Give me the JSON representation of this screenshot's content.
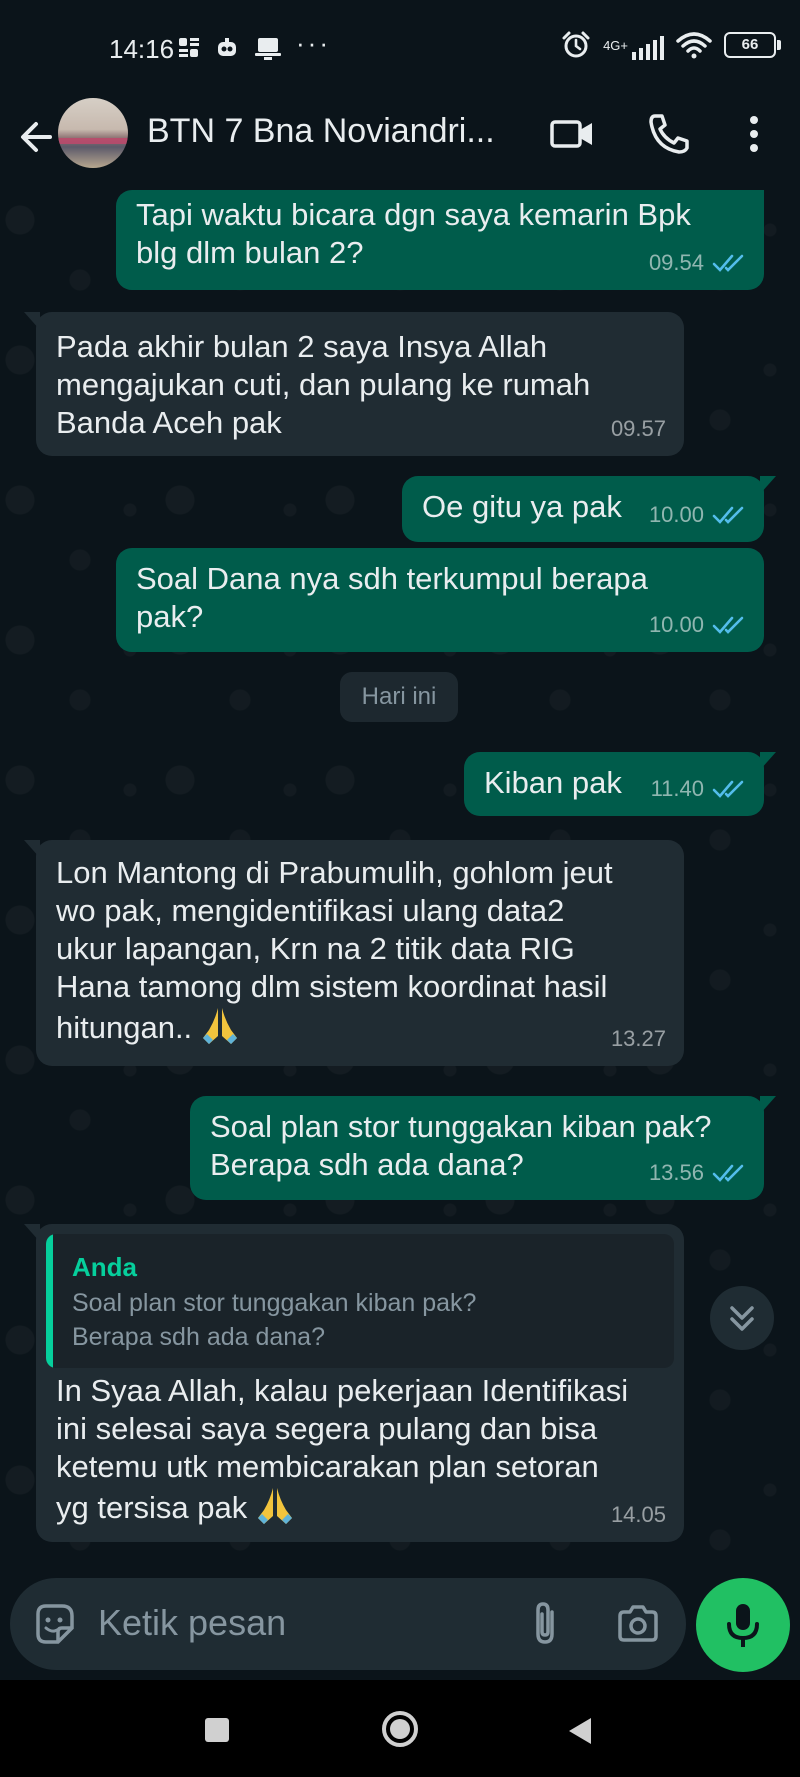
{
  "status_bar": {
    "time": "14:16",
    "overflow": "···",
    "network": "4G+",
    "battery": "66",
    "icons": [
      "grid-icon",
      "robot-icon",
      "laptop-icon",
      "alarm-icon",
      "signal-icon",
      "wifi-icon",
      "battery-icon"
    ]
  },
  "header": {
    "contact_name": "BTN 7 Bna Noviandri...",
    "icons": [
      "back-arrow-icon",
      "video-call-icon",
      "phone-icon",
      "more-vertical-icon"
    ]
  },
  "date_separator": "Hari ini",
  "messages": [
    {
      "dir": "out",
      "text": "Tapi waktu bicara dgn saya kemarin Bpk\nblg dlm bulan 2?",
      "time": "09.54"
    },
    {
      "dir": "in",
      "text": "Pada akhir bulan 2 saya Insya Allah\nmengajukan cuti, dan pulang ke rumah\nBanda Aceh pak",
      "time": "09.57"
    },
    {
      "dir": "out",
      "text": "Oe gitu ya pak",
      "time": "10.00"
    },
    {
      "dir": "out",
      "text": "Soal Dana nya sdh terkumpul berapa\npak?",
      "time": "10.00"
    },
    {
      "dir": "out",
      "text": "Kiban pak",
      "time": "11.40"
    },
    {
      "dir": "in",
      "text": "Lon Mantong di Prabumulih, gohlom jeut\nwo pak, mengidentifikasi ulang data2\nukur lapangan, Krn na 2 titik data RIG\nHana tamong dlm sistem koordinat hasil\nhitungan..",
      "time": "13.27"
    },
    {
      "dir": "out",
      "text": "Soal plan stor tunggakan kiban pak?\nBerapa sdh ada dana?",
      "time": "13.56"
    },
    {
      "dir": "in",
      "quote_author": "Anda",
      "quote_text": "Soal plan stor tunggakan kiban pak?\nBerapa sdh ada dana?",
      "text": "In Syaa Allah, kalau pekerjaan Identifikasi\nini selesai saya segera pulang dan bisa\nketemu utk membicarakan plan setoran\nyg tersisa pak",
      "time": "14.05"
    }
  ],
  "composer": {
    "placeholder": "Ketik pesan",
    "icons": [
      "sticker-icon",
      "attach-icon",
      "camera-icon",
      "mic-icon"
    ]
  },
  "colors": {
    "background": "#0b141a",
    "outgoing_bubble": "#005c4b",
    "incoming_bubble": "#202c33",
    "read_tick": "#53bdeb",
    "accent_green": "#21c063",
    "quote_accent": "#06cf9c"
  }
}
